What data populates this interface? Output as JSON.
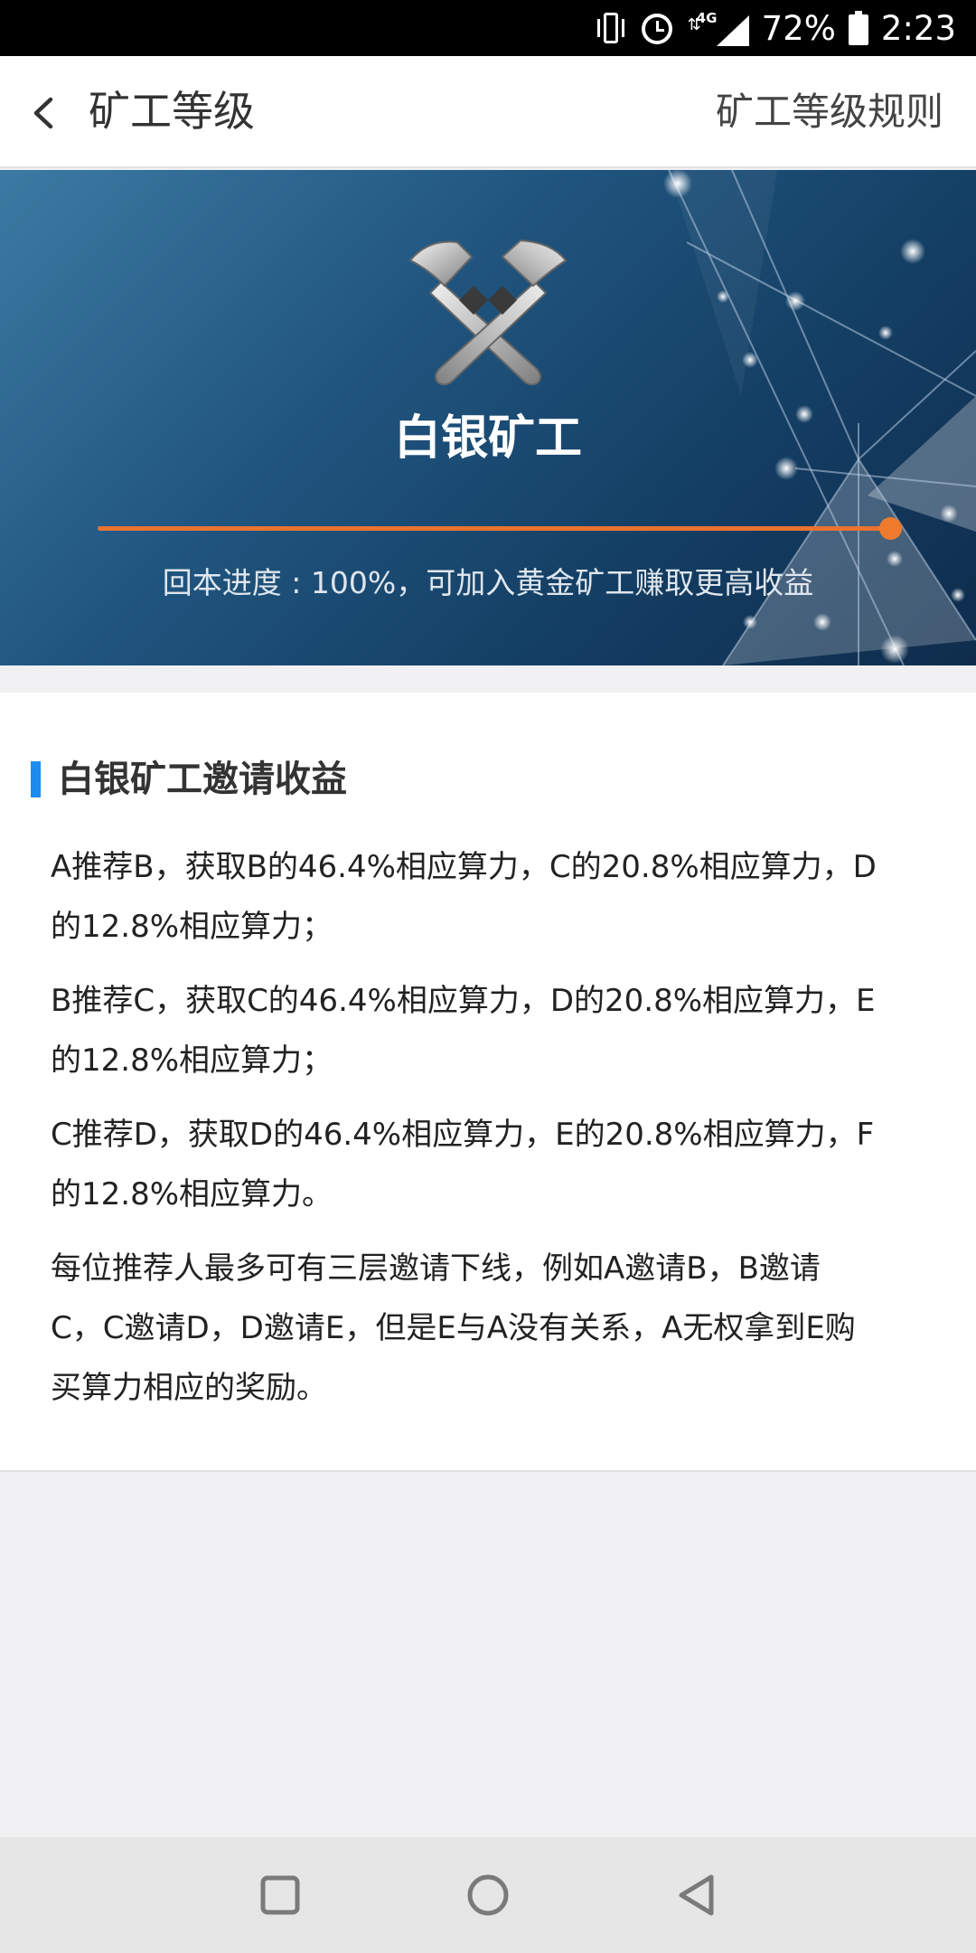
{
  "status_bar": {
    "network": "4G",
    "battery": "72%",
    "time": "2:23"
  },
  "header": {
    "title": "矿工等级",
    "rules_link": "矿工等级规则"
  },
  "banner": {
    "level_name": "白银矿工",
    "progress": 1.0,
    "progress_text": "回本进度 : 100%，可加入黄金矿工赚取更高收益"
  },
  "section": {
    "title": "白银矿工邀请收益",
    "paragraphs": [
      [
        "A推荐B，获取B的46.4%相应算力，C的20.8%相应算力，D",
        "的12.8%相应算力；"
      ],
      [
        "B推荐C，获取C的46.4%相应算力，D的20.8%相应算力，E",
        "的12.8%相应算力；"
      ],
      [
        "C推荐D，获取D的46.4%相应算力，E的20.8%相应算力，F",
        "的12.8%相应算力。"
      ],
      [
        "每位推荐人最多可有三层邀请下线，例如A邀请B，B邀请",
        "C，C邀请D，D邀请E，但是E与A没有关系，A无权拿到E购",
        "买算力相应的奖励。"
      ]
    ]
  },
  "colors": {
    "accent_blue": "#1d8cf0",
    "progress_orange": "#f07a2c"
  },
  "icons": {
    "back": "chevron-left-icon",
    "badge": "crossed-hammers-icon",
    "nav": [
      "recent-apps-icon",
      "home-icon",
      "back-triangle-icon"
    ]
  }
}
